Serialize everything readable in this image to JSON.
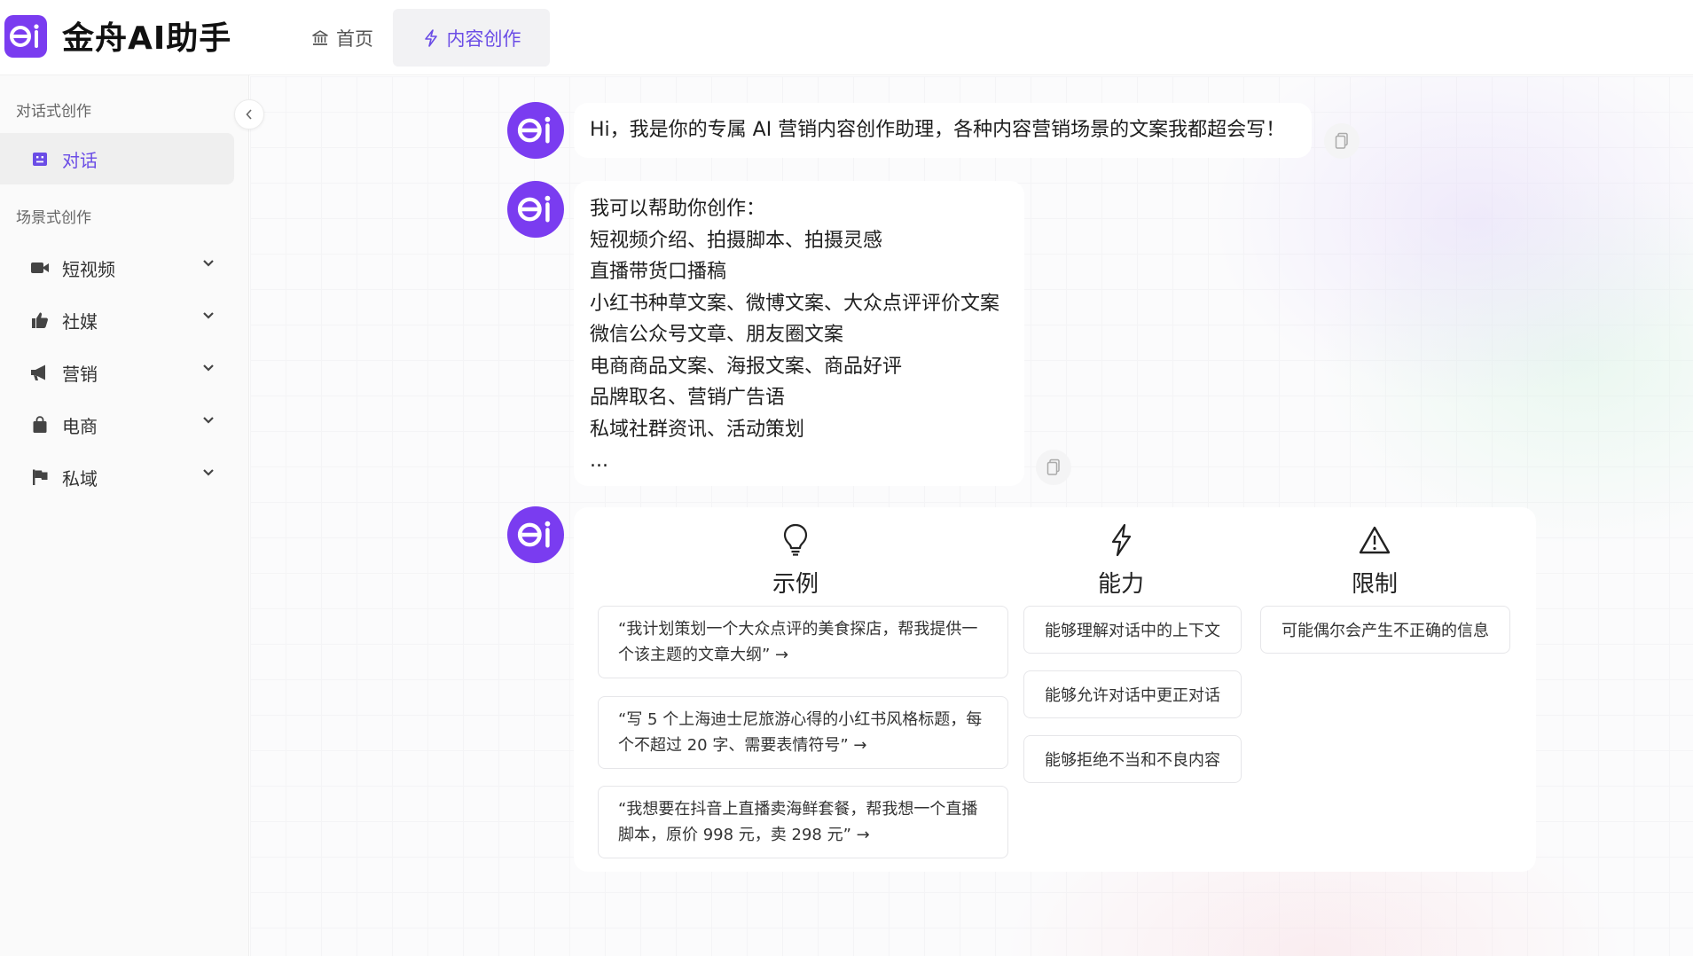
{
  "app": {
    "title": "金舟AI助手",
    "logo_text": "ai"
  },
  "nav": {
    "home_label": "首页",
    "create_label": "内容创作",
    "active": "内容创作"
  },
  "sidebar": {
    "section_chat": "对话式创作",
    "chat_item": "对话",
    "section_scene": "场景式创作",
    "items": [
      {
        "label": "短视频",
        "icon": "video-icon"
      },
      {
        "label": "社媒",
        "icon": "thumbs-up-icon"
      },
      {
        "label": "营销",
        "icon": "megaphone-icon"
      },
      {
        "label": "电商",
        "icon": "shopping-bag-icon"
      },
      {
        "label": "私域",
        "icon": "flag-icon"
      }
    ]
  },
  "chat": {
    "greeting": "Hi，我是你的专属 AI 营销内容创作助理，各种内容营销场景的文案我都超会写！",
    "capabilities_lines": [
      "我可以帮助你创作：",
      "短视频介绍、拍摄脚本、拍摄灵感",
      "直播带货口播稿",
      "小红书种草文案、微博文案、大众点评评价文案",
      "微信公众号文章、朋友圈文案",
      "电商商品文案、海报文案、商品好评",
      "品牌取名、营销广告语",
      "私域社群资讯、活动策划",
      "..."
    ]
  },
  "card": {
    "examples_title": "示例",
    "abilities_title": "能力",
    "limits_title": "限制",
    "examples": [
      "“我计划策划一个大众点评的美食探店，帮我提供一个该主题的文章大纲” →",
      "“写 5 个上海迪士尼旅游心得的小红书风格标题，每个不超过 20 字、需要表情符号” →",
      "“我想要在抖音上直播卖海鲜套餐，帮我想一个直播脚本，原价 998 元，卖 298 元” →"
    ],
    "abilities": [
      "能够理解对话中的上下文",
      "能够允许对话中更正对话",
      "能够拒绝不当和不良内容"
    ],
    "limits": [
      "可能偶尔会产生不正确的信息"
    ]
  },
  "colors": {
    "brand": "#7a3cf0",
    "accent": "#6b4de6"
  }
}
